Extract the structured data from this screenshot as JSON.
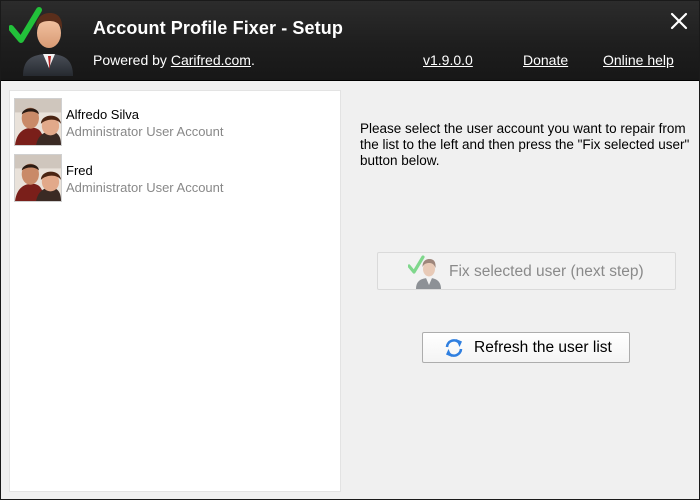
{
  "header": {
    "title": "Account Profile Fixer - Setup",
    "powered_prefix": "Powered by ",
    "powered_link": "Carifred.com",
    "powered_suffix": ".",
    "version": "v1.9.0.0",
    "donate": "Donate",
    "online_help": "Online help",
    "logo_icon": "user-checkmark-icon",
    "close_icon": "close-icon"
  },
  "users": [
    {
      "name": "Alfredo Silva",
      "type": "Administrator User Account",
      "avatar_icon": "user-photo-avatar"
    },
    {
      "name": "Fred",
      "type": "Administrator User Account",
      "avatar_icon": "user-photo-avatar"
    }
  ],
  "instructions": "Please select the user account you want to repair from the list to the left and then press the \"Fix selected user\" button below.",
  "buttons": {
    "fix": {
      "label": "Fix selected user (next step)",
      "icon": "user-fix-icon",
      "enabled": false
    },
    "refresh": {
      "label": "Refresh the user list",
      "icon": "refresh-arrows-icon",
      "enabled": true
    }
  },
  "colors": {
    "header_bg": "#1e1e1e",
    "check_green": "#22c13a",
    "refresh_blue": "#2f7fe0",
    "disabled_text": "#8a8a8a",
    "secondary_text": "#888888"
  }
}
